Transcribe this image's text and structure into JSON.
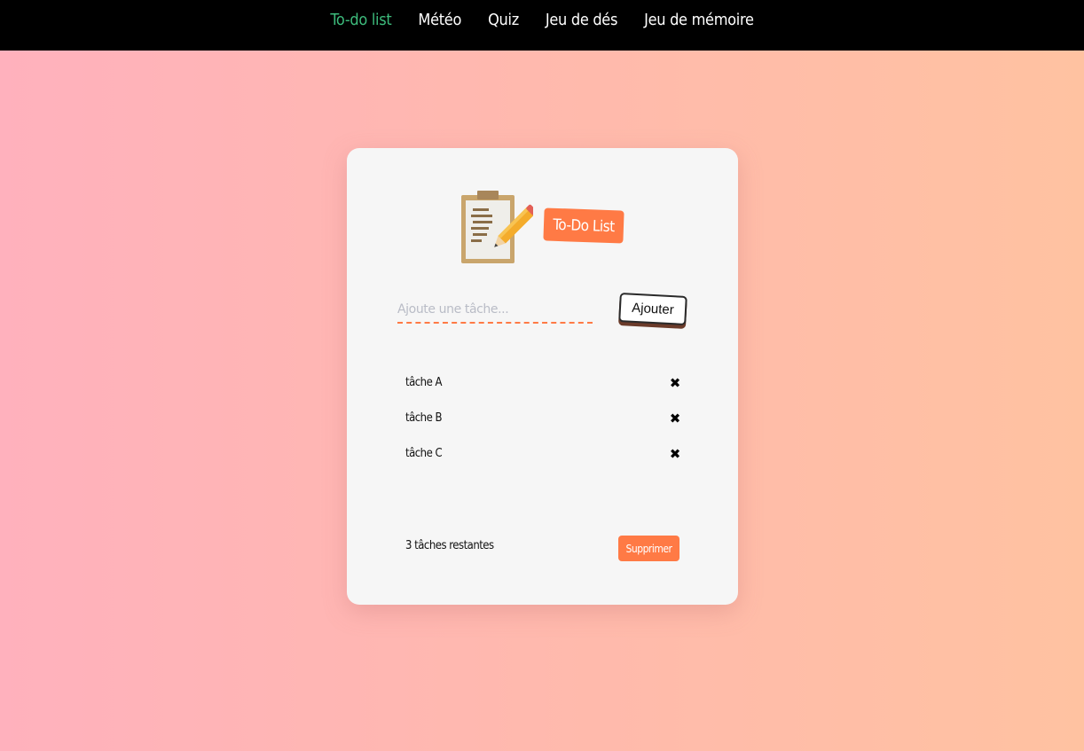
{
  "nav": {
    "items": [
      {
        "label": "To-do list",
        "active": true
      },
      {
        "label": "Météo",
        "active": false
      },
      {
        "label": "Quiz",
        "active": false
      },
      {
        "label": "Jeu de dés",
        "active": false
      },
      {
        "label": "Jeu de mémoire",
        "active": false
      }
    ]
  },
  "app": {
    "logo_icon": "clipboard-pencil-icon",
    "title": "To-Do List",
    "input_placeholder": "Ajoute une tâche...",
    "input_value": "",
    "add_label": "Ajouter",
    "tasks": [
      {
        "text": "tâche A",
        "delete_symbol": "✖"
      },
      {
        "text": "tâche B",
        "delete_symbol": "✖"
      },
      {
        "text": "tâche C",
        "delete_symbol": "✖"
      }
    ],
    "remaining_text": "3 tâches restantes",
    "clear_label": "Supprimer"
  },
  "colors": {
    "accent": "#ff7a45",
    "nav_active": "#3dbb7c",
    "nav_background": "#000000",
    "card_background": "#f6f6f6"
  }
}
